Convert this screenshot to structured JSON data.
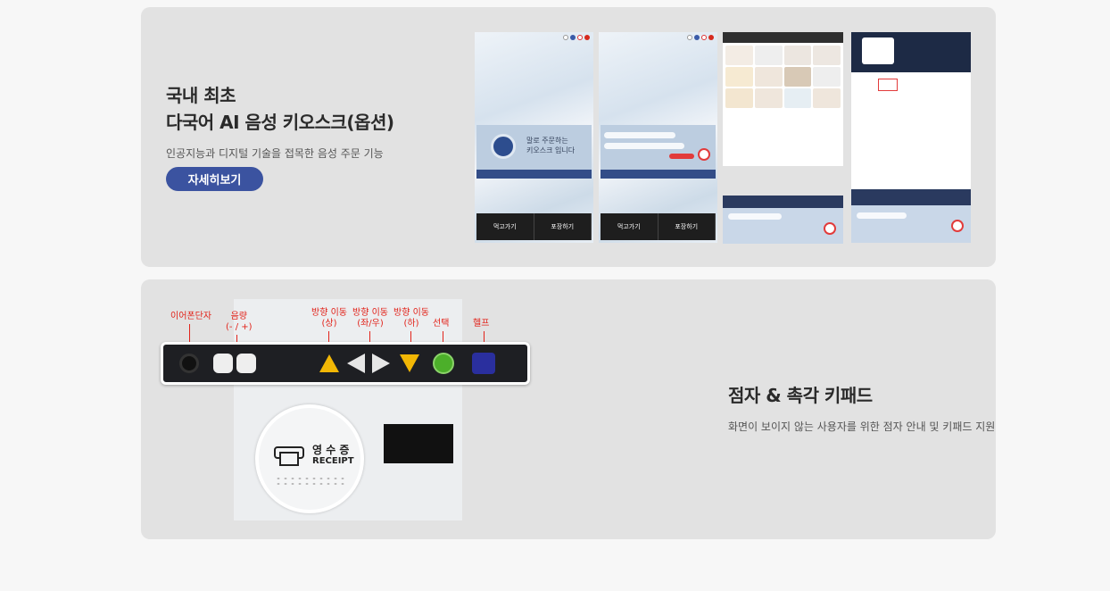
{
  "feature1": {
    "title_line1": "국내 최초",
    "title_line2": "다국어 AI 음성 키오스크(옵션)",
    "description": "인공지능과 디지털 기술을 접목한 음성 주문 기능",
    "button_label": "자세히보기",
    "kiosk_screens": [
      {
        "voice_line1": "말로 주문하는",
        "voice_line2": "키오스크 입니다",
        "option1": "먹고가기",
        "option2": "포장하기"
      },
      {
        "option1": "먹고가기",
        "option2": "포장하기"
      }
    ]
  },
  "feature2": {
    "title": "점자 & 촉각 키패드",
    "description": "화면이 보이지 않는 사용자를 위한 점자 안내 및 키패드 지원",
    "keypad_labels": {
      "earphone": "이어폰단자",
      "volume_line1": "음량",
      "volume_line2": "(- / +)",
      "up_line1": "방향 이동",
      "up_line2": "(상)",
      "lr_line1": "방향 이동",
      "lr_line2": "(좌/우)",
      "down_line1": "방향 이동",
      "down_line2": "(하)",
      "select": "선택",
      "help": "헬프"
    },
    "receipt_ko": "영 수 증",
    "receipt_en": "RECEIPT"
  },
  "colors": {
    "background": "#f7f7f7",
    "card": "#e2e2e2",
    "button": "#3b53a0",
    "annotation": "#e2231a"
  }
}
